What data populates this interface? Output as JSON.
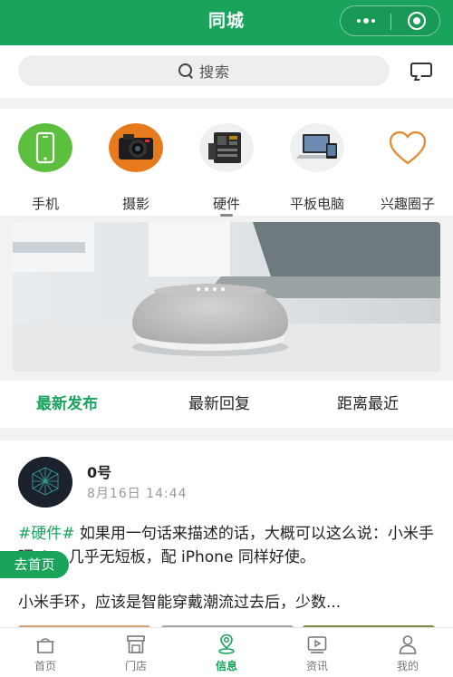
{
  "header": {
    "title": "同城"
  },
  "search": {
    "placeholder": "搜索"
  },
  "categories": [
    {
      "label": "手机",
      "icon": "phone-icon"
    },
    {
      "label": "摄影",
      "icon": "camera-icon"
    },
    {
      "label": "硬件",
      "icon": "hardware-icon"
    },
    {
      "label": "平板电脑",
      "icon": "tablet-laptop-icon"
    },
    {
      "label": "兴趣圈子",
      "icon": "heart-icon"
    }
  ],
  "sort_tabs": [
    {
      "label": "最新发布",
      "active": true
    },
    {
      "label": "最新回复",
      "active": false
    },
    {
      "label": "距离最近",
      "active": false
    }
  ],
  "post": {
    "author": "0号",
    "time": "8月16日 14:44",
    "tag": "#硬件#",
    "text": " 如果用一句话来描述的话，大概可以这么说：小米手环 4 ，几乎无短板，配 iPhone 同样好使。",
    "text2": "小米手环，应该是智能穿戴潮流过去后，少数..."
  },
  "floating": {
    "go_home": "去首页"
  },
  "bottom_nav": [
    {
      "label": "首页",
      "icon": "home-icon",
      "active": false
    },
    {
      "label": "门店",
      "icon": "store-icon",
      "active": false
    },
    {
      "label": "信息",
      "icon": "location-icon",
      "active": true
    },
    {
      "label": "资讯",
      "icon": "video-icon",
      "active": false
    },
    {
      "label": "我的",
      "icon": "user-icon",
      "active": false
    }
  ],
  "colors": {
    "brand": "#1aa35b",
    "text": "#222222",
    "muted": "#999999"
  }
}
